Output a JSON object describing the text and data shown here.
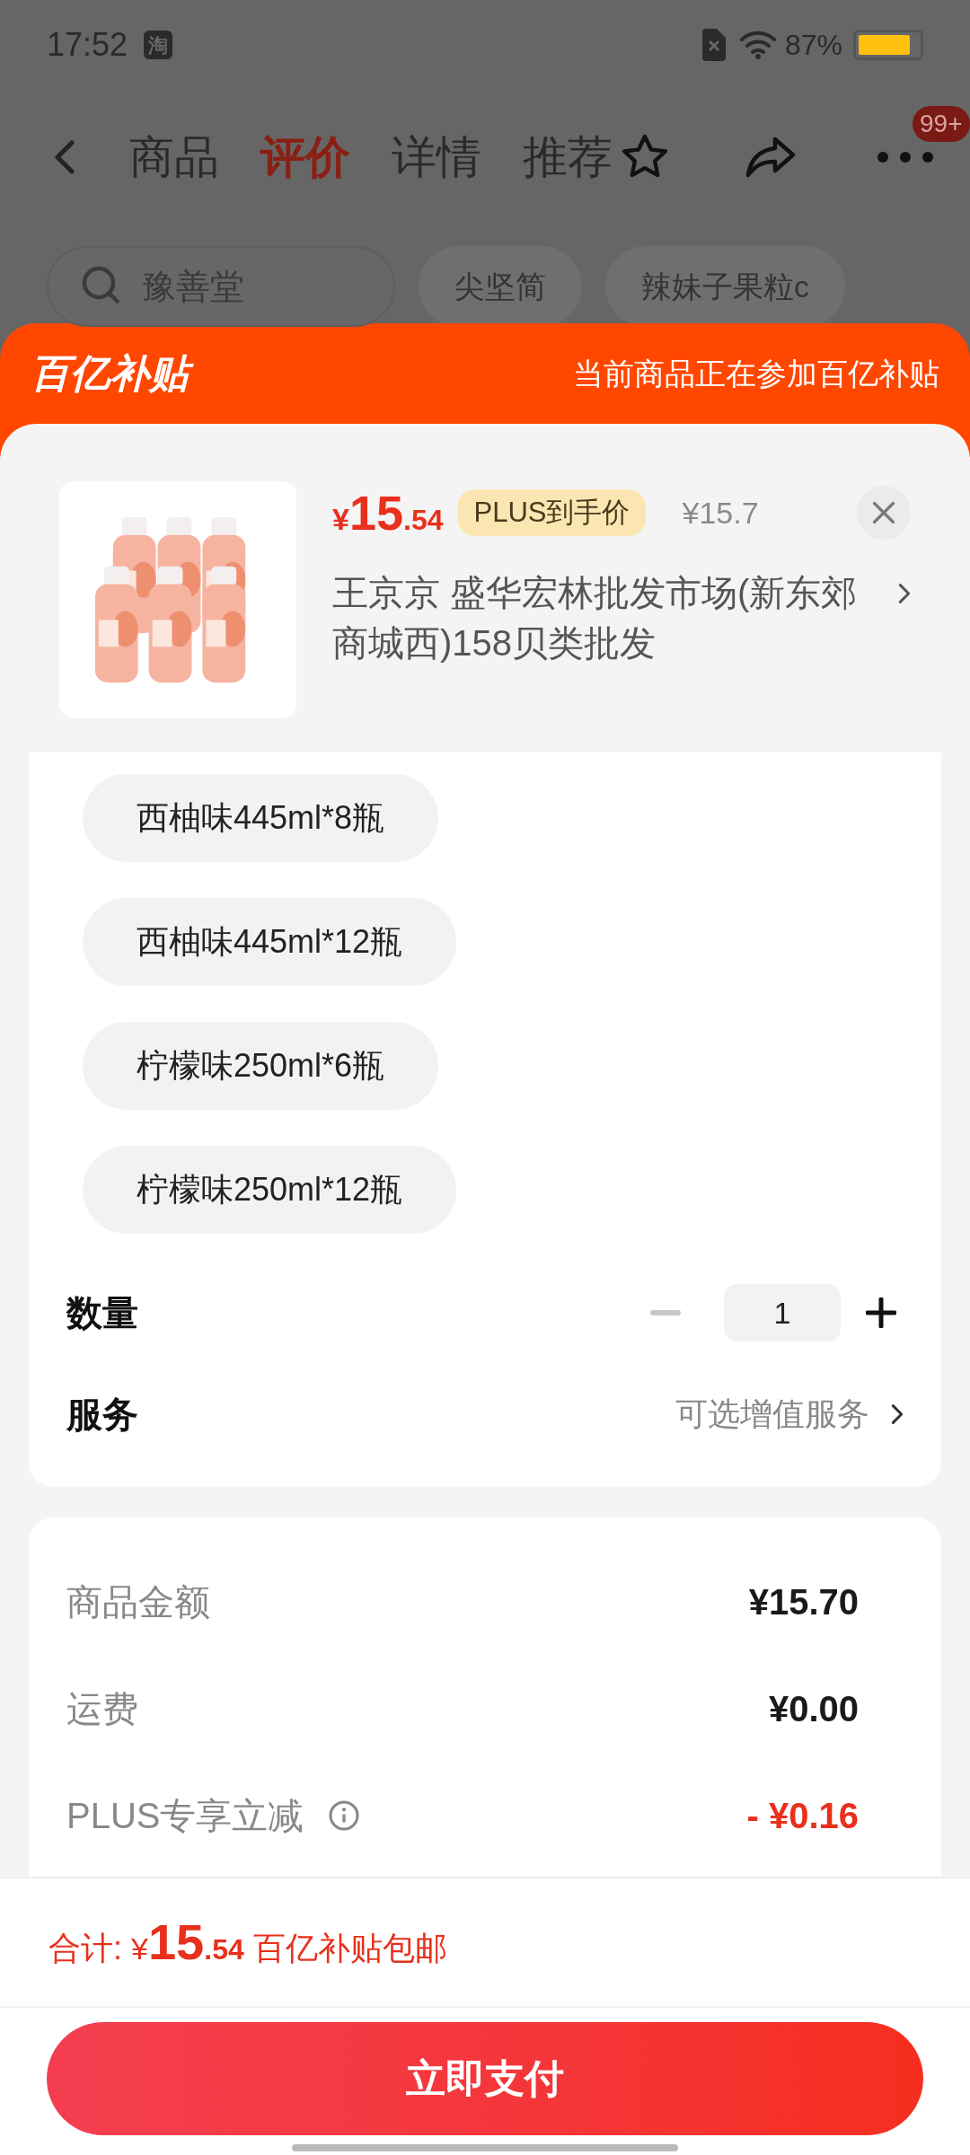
{
  "status_bar": {
    "time": "17:52",
    "app_badge": "淘",
    "battery_text": "87%"
  },
  "nav": {
    "tabs": [
      {
        "label": "商品",
        "selected": false
      },
      {
        "label": "评价",
        "selected": true
      },
      {
        "label": "详情",
        "selected": false
      },
      {
        "label": "推荐",
        "selected": false
      }
    ],
    "more_badge": "99+"
  },
  "search": {
    "placeholder": "豫善堂",
    "chips": [
      "尖坚简",
      "辣妹子果粒c"
    ]
  },
  "sheet": {
    "brand": "百亿补贴",
    "banner_text": "当前商品正在参加百亿补贴",
    "product": {
      "price_currency": "¥",
      "price_integer": "15",
      "price_decimal": ".54",
      "price_tag": "PLUS到手价",
      "original_price": "¥15.7",
      "shop": "王京京  盛华宏林批发市场(新东郊商城西)158贝类批发"
    },
    "options": [
      {
        "label": "西柚味445ml*8瓶",
        "selected": false
      },
      {
        "label": "西柚味445ml*12瓶",
        "selected": false
      },
      {
        "label": "柠檬味250ml*6瓶",
        "selected": false
      },
      {
        "label": "柠檬味250ml*12瓶",
        "selected": false
      }
    ],
    "quantity": {
      "label": "数量",
      "value": "1",
      "decrease_disabled": true
    },
    "service": {
      "label": "服务",
      "value": "可选增值服务"
    },
    "summary": [
      {
        "label": "商品金额",
        "value": "¥15.70",
        "kind": "normal"
      },
      {
        "label": "运费",
        "value": "¥0.00",
        "kind": "normal"
      },
      {
        "label": "PLUS专享立减",
        "value": "- ¥0.16",
        "kind": "discount"
      }
    ],
    "total": {
      "label": "合计:",
      "currency": "¥",
      "integer": "15",
      "decimal": ".54",
      "note": "百亿补贴包邮"
    },
    "pay_button": "立即支付"
  }
}
